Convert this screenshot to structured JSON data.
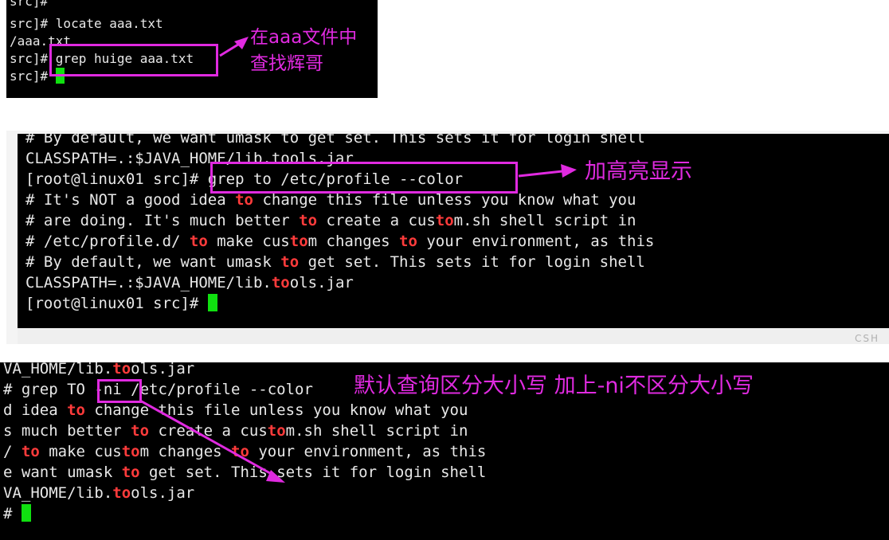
{
  "panel1": {
    "lines": [
      "src]#",
      "src]# locate aaa.txt",
      "/aaa.txt",
      "src]# grep huige aaa.txt",
      "src]# "
    ],
    "annotation": [
      "在aaa文件中",
      "查找辉哥"
    ]
  },
  "panel2": {
    "lines": [
      [
        "# By default, we want umask to get set. This sets it for login shell"
      ],
      [
        "CLASSPATH=.:$JAVA_HOME/lib.tools.jar"
      ],
      [
        "[root@linux01 src]# grep to /etc/profile --color"
      ],
      [
        "# It's NOT a good idea ",
        {
          "hl": "to"
        },
        " change this file unless you know what you"
      ],
      [
        "# are doing. It's much better ",
        {
          "hl": "to"
        },
        " create a cus",
        {
          "hl": "to"
        },
        "m.sh shell script in"
      ],
      [
        "# /etc/profile.d/ ",
        {
          "hl": "to"
        },
        " make cus",
        {
          "hl": "to"
        },
        "m changes ",
        {
          "hl": "to"
        },
        " your environment, as this"
      ],
      [
        "# By default, we want umask ",
        {
          "hl": "to"
        },
        " get set. This sets it for login shell"
      ],
      [
        "CLASSPATH=.:$JAVA_HOME/lib.",
        {
          "hl": "to"
        },
        "ols.jar"
      ],
      [
        "[root@linux01 src]# "
      ]
    ],
    "annotation": "加高亮显示",
    "status_fragment": "CSH"
  },
  "panel3": {
    "lines": [
      [
        "VA_HOME/lib.",
        {
          "hl": "to"
        },
        "ols.jar"
      ],
      [
        "# grep TO -ni /etc/profile --color"
      ],
      [
        "d idea ",
        {
          "hl": "to"
        },
        " change this file unless you know what you"
      ],
      [
        "s much better ",
        {
          "hl": "to"
        },
        " create a cus",
        {
          "hl": "to"
        },
        "m.sh shell script in"
      ],
      [
        "/ ",
        {
          "hl": "to"
        },
        " make cus",
        {
          "hl": "to"
        },
        "m changes ",
        {
          "hl": "to"
        },
        " your environment, as this"
      ],
      [
        "e want umask ",
        {
          "hl": "to"
        },
        " get set. This sets it for login shell"
      ],
      [
        "VA_HOME/lib.",
        {
          "hl": "to"
        },
        "ols.jar"
      ],
      [
        "# "
      ]
    ],
    "annotation": "默认查询区分大小写 加上-ni不区分大小写"
  },
  "colors": {
    "annotation": "#e02ae0",
    "highlight": "#ff3b3b",
    "cursor": "#10e010",
    "terminal_bg": "#000000"
  }
}
